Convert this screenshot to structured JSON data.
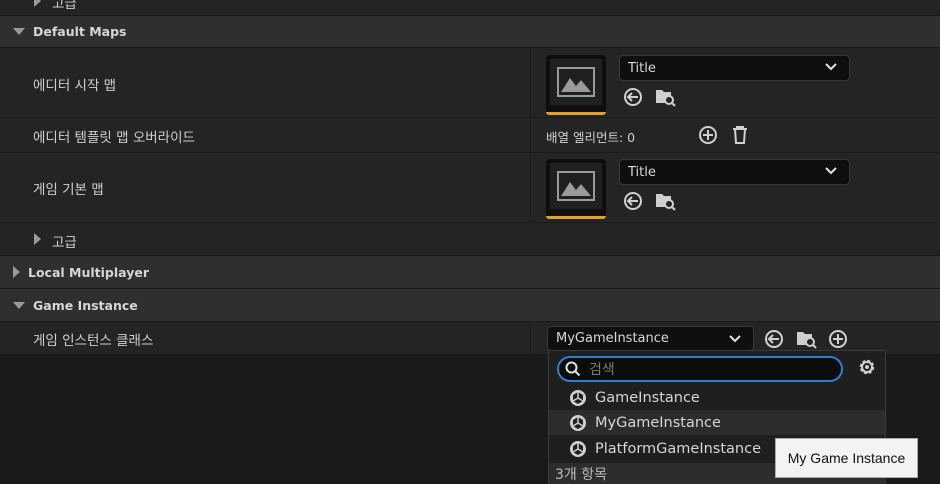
{
  "top_partial": {
    "label": "고급"
  },
  "default_maps": {
    "header": "Default Maps",
    "editor_startup_map": {
      "label": "에디터 시작 맵",
      "value": "Title"
    },
    "editor_template_override": {
      "label": "에디터 템플릿 맵 오버라이드",
      "array_text": "배열 엘리먼트: 0"
    },
    "game_default_map": {
      "label": "게임 기본 맵",
      "value": "Title"
    },
    "advanced": {
      "label": "고급"
    }
  },
  "local_multiplayer": {
    "header": "Local Multiplayer"
  },
  "game_instance": {
    "header": "Game Instance",
    "class_label": "게임 인스턴스 클래스",
    "class_value": "MyGameInstance"
  },
  "dropdown": {
    "search_placeholder": "검색",
    "options": [
      "GameInstance",
      "MyGameInstance",
      "PlatformGameInstance"
    ],
    "footer": "3개 항목"
  },
  "tooltip": "My Game Instance",
  "colors": {
    "accent": "#e8a020",
    "focus": "#2a7fd6"
  }
}
